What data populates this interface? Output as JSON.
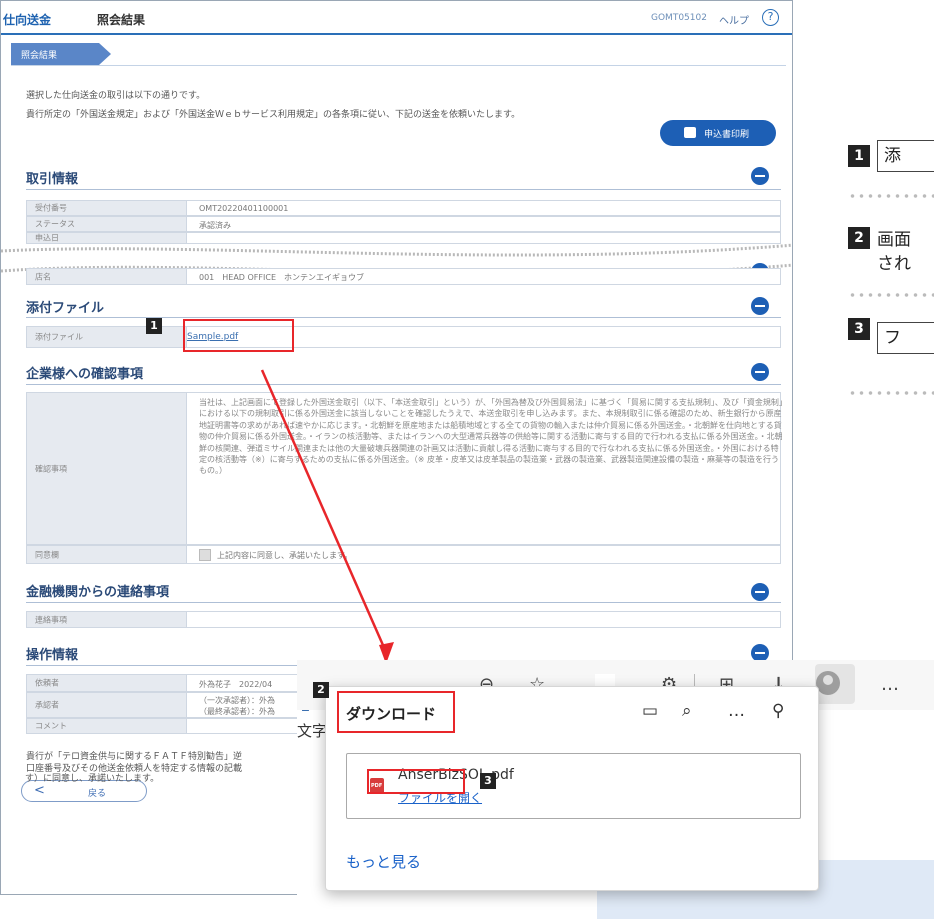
{
  "header": {
    "title": "仕向送金",
    "subtitle": "照会結果",
    "screen_code": "GOMT05102",
    "help_label": "ヘルプ",
    "help_icon": "?"
  },
  "breadcrumb": {
    "current": "照会結果"
  },
  "intro": {
    "line1": "選択した仕向送金の取引は以下の通りです。",
    "line2": "貴行所定の「外国送金規定」および「外国送金Ｗｅｂサービス利用規定」の各条項に従い、下記の送金を依頼いたします。"
  },
  "print_button": {
    "label": "申込書印刷"
  },
  "sections": {
    "transaction_info": "取引情報",
    "attachment": "添付ファイル",
    "company_confirm": "企業様への確認事項",
    "bank_notice": "金融機関からの連絡事項",
    "operation_info": "操作情報"
  },
  "transaction_rows": [
    {
      "label": "受付番号",
      "value": "OMT20220401100001"
    },
    {
      "label": "ステータス",
      "value": "承認済み"
    },
    {
      "label": "申込日",
      "value": ""
    }
  ],
  "branch_row": {
    "label": "店名",
    "value": "001　HEAD OFFICE　ホンテンエイギョウブ"
  },
  "attachment_row": {
    "label": "添付ファイル",
    "file": "Sample.pdf"
  },
  "confirm_row": {
    "label": "確認事項",
    "text": "当社は、上記画面にて登録した外国送金取引（以下、「本送金取引」という）が、「外国為替及び外国貿易法」に基づく「貿易に関する支払規制」、及び「資金規制」における以下の規制取引に係る外国送金に該当しないことを確認したうえで、本送金取引を申し込みます。また、本規制取引に係る確認のため、新生銀行から原産地証明書等の求めがあれば速やかに応じます。・北朝鮮を原産地または船積地域とする全ての貨物の輸入または仲介貿易に係る外国送金。・北朝鮮を仕向地とする貨物の仲介貿易に係る外国送金。・イランの核活動等、またはイランへの大型通常兵器等の供給等に関する活動に寄与する目的で行われる支払に係る外国送金。・北朝鮮の核関連、弾道ミサイル関連または他の大量破壊兵器関連の計画又は活動に貢献し得る活動に寄与する目的で行なわれる支払に係る外国送金。・外国における特定の核活動等（※）に寄与するための支払に係る外国送金。（※ 皮革・皮革又は皮革製品の製造業・武器の製造業、武器製造関連設備の製造・麻薬等の製造を行うもの。）",
    "agree_label": "同意欄",
    "agree_text": "上記内容に同意し、承諾いたします。"
  },
  "bank_notice_row": {
    "label": "連絡事項",
    "value": ""
  },
  "operation_rows": [
    {
      "label": "依頼者",
      "value": "外為花子　2022/04"
    },
    {
      "label": "承認者",
      "value": "（一次承認者）：外為"
    },
    {
      "label": "",
      "value": "（最終承認者）：外為"
    },
    {
      "label": "コメント",
      "value": ""
    }
  ],
  "footer_text": {
    "line1": "貴行が「テロ資金供与に関するＦＡＴＦ特別勧告」逆",
    "line2": "口座番号及びその他送金依頼人を特定する情報の記載",
    "line3": "す）に同意し、承諾いたします。"
  },
  "back_button": {
    "arrow": "<",
    "label": "戻る"
  },
  "browser": {
    "partial_left_text": "文字",
    "partial_left_num": "2",
    "download_panel": {
      "title": "ダウンロード",
      "file_name": "AnserBizSOL.pdf",
      "open_link": "ファイルを開く",
      "more_link": "もっと見る"
    }
  },
  "badges": {
    "n1": "1",
    "n2": "2",
    "n3": "3"
  },
  "legend": {
    "item1": "添",
    "item2_line1": "画面",
    "item2_line2": "され",
    "item3": "フ"
  },
  "colors": {
    "accent": "#1d5fb5",
    "highlight": "#e8262a",
    "arrow": "#e8262a"
  }
}
